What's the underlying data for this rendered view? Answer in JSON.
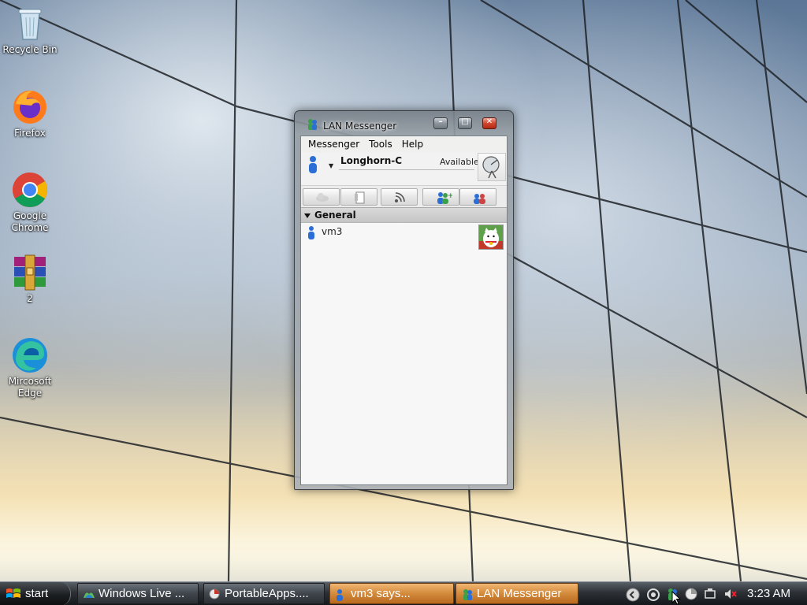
{
  "desktop": {
    "icons": [
      {
        "label": "Recycle Bin"
      },
      {
        "label": "Firefox"
      },
      {
        "label": "Google Chrome"
      },
      {
        "label": "2"
      },
      {
        "label": "Mircosoft Edge"
      }
    ]
  },
  "window": {
    "title": "LAN Messenger",
    "menu": [
      "Messenger",
      "Tools",
      "Help"
    ],
    "user": {
      "name": "Longhorn-C",
      "status": "Available"
    },
    "group": "General",
    "contacts": [
      {
        "name": "vm3"
      }
    ]
  },
  "taskbar": {
    "start_label": "start",
    "tasks": [
      {
        "label": "Windows Live ..."
      },
      {
        "label": "PortableApps...."
      },
      {
        "label": "vm3 says..."
      },
      {
        "label": "LAN Messenger"
      }
    ],
    "clock": "3:23 AM"
  },
  "colors": {
    "flash_task": "#d38a3b",
    "close_button": "#d2452e"
  }
}
